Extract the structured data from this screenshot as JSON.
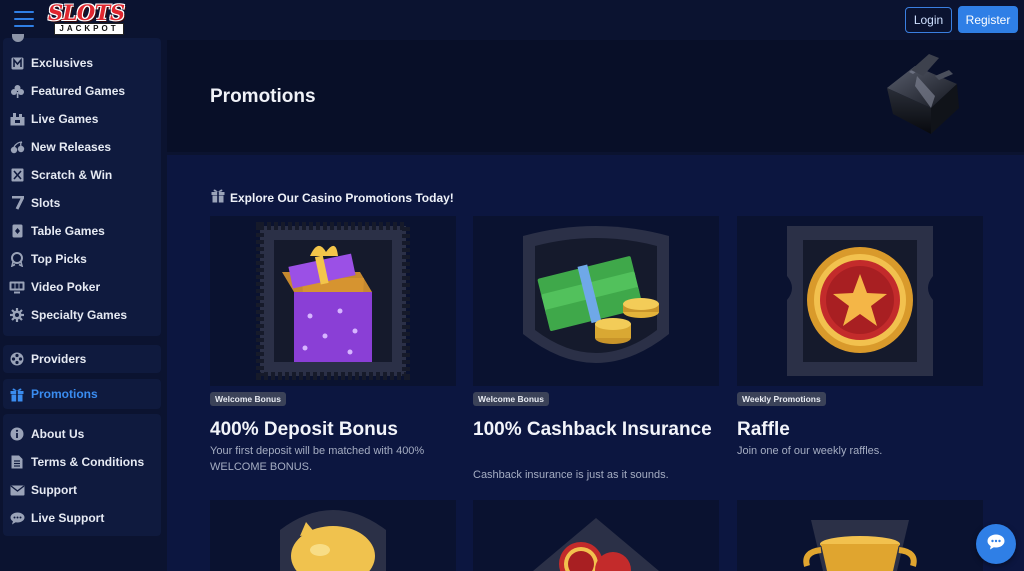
{
  "header": {
    "logo_top": "SLOTS",
    "logo_bottom": "JACKPOT",
    "login_label": "Login",
    "register_label": "Register"
  },
  "sidebar": {
    "group1": [
      {
        "label": "Exclusives",
        "icon": "exclusives-icon"
      },
      {
        "label": "Featured Games",
        "icon": "clover-icon"
      },
      {
        "label": "Live Games",
        "icon": "live-games-icon"
      },
      {
        "label": "New Releases",
        "icon": "cherries-icon"
      },
      {
        "label": "Scratch & Win",
        "icon": "scratch-card-icon"
      },
      {
        "label": "Slots",
        "icon": "seven-icon"
      },
      {
        "label": "Table Games",
        "icon": "playing-card-icon"
      },
      {
        "label": "Top Picks",
        "icon": "badge-icon"
      },
      {
        "label": "Video Poker",
        "icon": "monitor-icon"
      },
      {
        "label": "Specialty Games",
        "icon": "gear-icon"
      }
    ],
    "providers": {
      "label": "Providers",
      "icon": "film-reel-icon"
    },
    "promotions": {
      "label": "Promotions",
      "icon": "gift-icon"
    },
    "group3": [
      {
        "label": "About Us",
        "icon": "info-icon"
      },
      {
        "label": "Terms & Conditions",
        "icon": "document-icon"
      },
      {
        "label": "Support",
        "icon": "envelope-icon"
      },
      {
        "label": "Live Support",
        "icon": "chat-icon"
      }
    ]
  },
  "hero": {
    "title": "Promotions"
  },
  "main": {
    "explore_label": "Explore Our Casino Promotions Today!",
    "cards": [
      {
        "badge": "Welcome Bonus",
        "title": "400% Deposit Bonus",
        "description": "Your first deposit will be matched with 400% WELCOME BONUS."
      },
      {
        "badge": "Welcome Bonus",
        "title": "100% Cashback Insurance",
        "description": "Cashback insurance is just as it sounds."
      },
      {
        "badge": "Weekly Promotions",
        "title": "Raffle",
        "description": "Join one of our weekly raffles."
      }
    ]
  },
  "colors": {
    "accent": "#2f7fe6",
    "background": "#0b1330",
    "panel": "#0c1640"
  }
}
